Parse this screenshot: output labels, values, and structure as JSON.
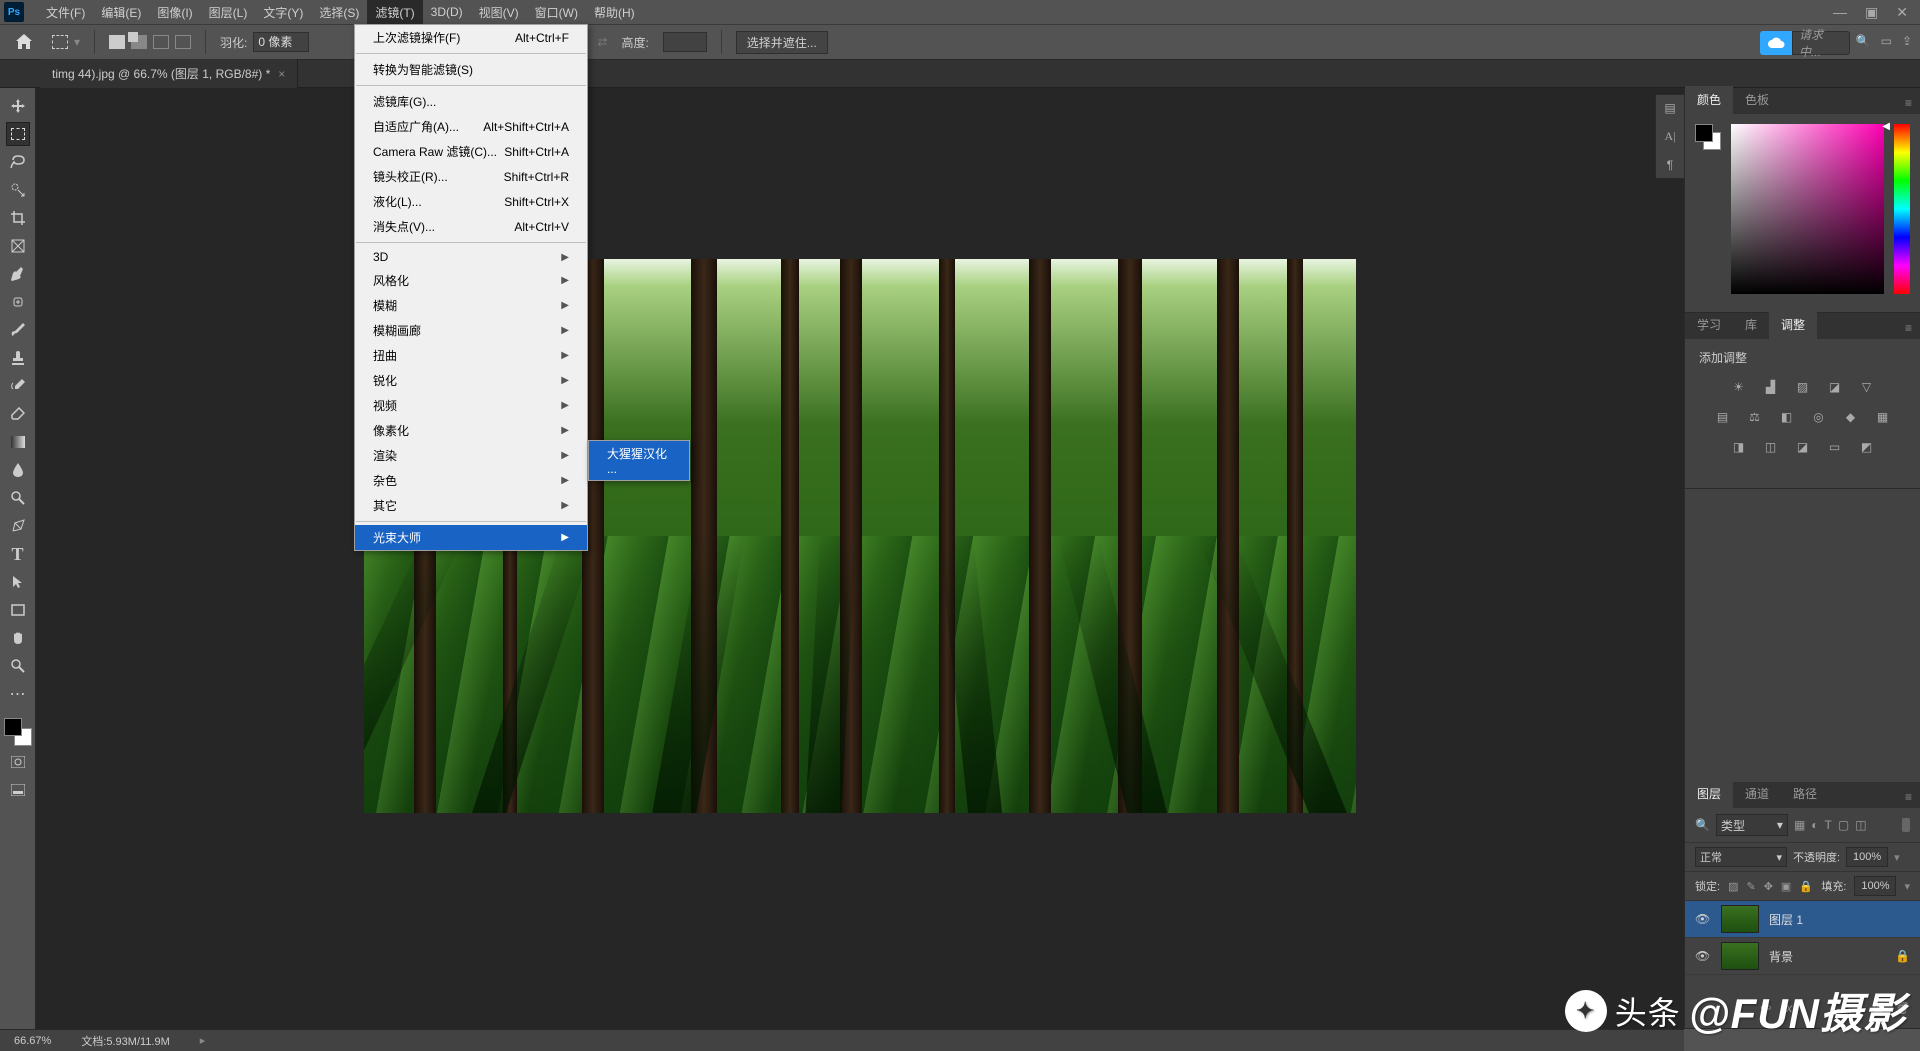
{
  "app": {
    "logo": "Ps"
  },
  "menubar": {
    "items": [
      "文件(F)",
      "编辑(E)",
      "图像(I)",
      "图层(L)",
      "文字(Y)",
      "选择(S)",
      "滤镜(T)",
      "3D(D)",
      "视图(V)",
      "窗口(W)",
      "帮助(H)"
    ]
  },
  "options": {
    "feather_label": "羽化:",
    "feather_value": "0 像素",
    "height_label": "高度:",
    "select_mask": "选择并遮住...",
    "search_placeholder": "请求中..."
  },
  "tab": {
    "title": "timg 44).jpg @ 66.7% (图层 1, RGB/8#) *"
  },
  "filter_menu": {
    "last_filter": "上次滤镜操作(F)",
    "last_filter_sc": "Alt+Ctrl+F",
    "smart_filter": "转换为智能滤镜(S)",
    "gallery": "滤镜库(G)...",
    "adaptive": "自适应广角(A)...",
    "adaptive_sc": "Alt+Shift+Ctrl+A",
    "camera_raw": "Camera Raw 滤镜(C)...",
    "camera_raw_sc": "Shift+Ctrl+A",
    "lens": "镜头校正(R)...",
    "lens_sc": "Shift+Ctrl+R",
    "liquify": "液化(L)...",
    "liquify_sc": "Shift+Ctrl+X",
    "vanish": "消失点(V)...",
    "vanish_sc": "Alt+Ctrl+V",
    "threed": "3D",
    "stylize": "风格化",
    "blur": "模糊",
    "blur_gallery": "模糊画廊",
    "distort": "扭曲",
    "sharpen": "锐化",
    "video": "视频",
    "pixelate": "像素化",
    "render": "渲染",
    "noise": "杂色",
    "other": "其它",
    "lightmaster": "光束大师",
    "submenu_item": "大猩猩汉化 ..."
  },
  "panels": {
    "color_tab": "颜色",
    "swatches_tab": "色板",
    "learn_tab": "学习",
    "libraries_tab": "库",
    "adjustments_tab": "调整",
    "add_adjustment": "添加调整",
    "layers_tab": "图层",
    "channels_tab": "通道",
    "paths_tab": "路径",
    "filter_kind": "类型",
    "blend_mode": "正常",
    "opacity_label": "不透明度:",
    "opacity_value": "100%",
    "lock_label": "锁定:",
    "fill_label": "填充:",
    "fill_value": "100%",
    "layer1_name": "图层 1",
    "background_name": "背景"
  },
  "status": {
    "zoom": "66.67%",
    "doc": "文档:5.93M/11.9M"
  },
  "watermark": {
    "prefix": "头条",
    "text": "@FUN摄影"
  }
}
